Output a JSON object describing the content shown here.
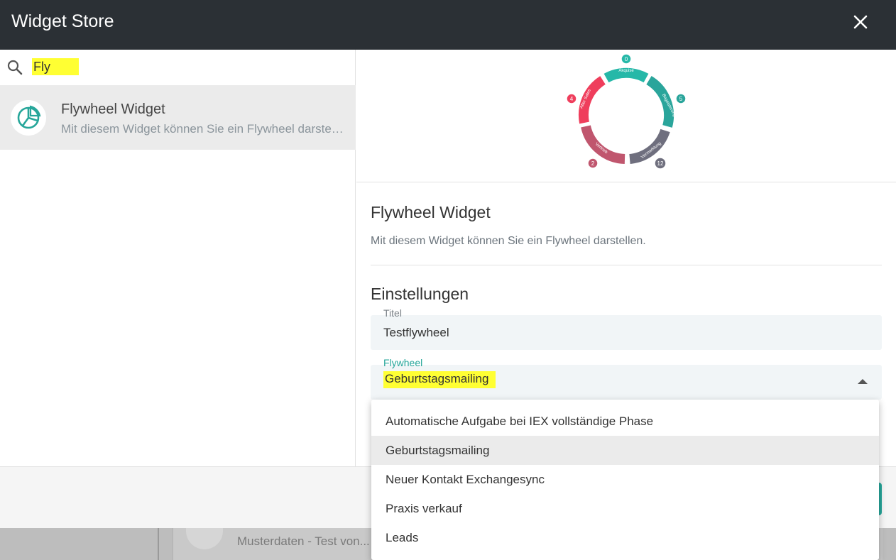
{
  "dialog": {
    "title": "Widget Store",
    "close_icon": "close-icon"
  },
  "search": {
    "icon": "search-icon",
    "value": "Fly",
    "highlight_color": "#ffff33"
  },
  "results": [
    {
      "icon": "flywheel-chart-icon",
      "title": "Flywheel Widget",
      "description": "Mit diesem Widget können Sie ein Flywheel darstellen."
    }
  ],
  "preview": {
    "segments": [
      {
        "label": "Akquise",
        "count": "0",
        "color": "#26b8a8"
      },
      {
        "label": "Begeisterung",
        "count": "5",
        "color": "#2aa59b"
      },
      {
        "label": "Vermarktung",
        "count": "12",
        "color": "#6f6f7e"
      },
      {
        "label": "Vertrieb",
        "count": "2",
        "color": "#c0566e"
      },
      {
        "label": "After Sales",
        "count": "4",
        "color": "#ef3e5c"
      }
    ]
  },
  "details": {
    "title": "Flywheel Widget",
    "description": "Mit diesem Widget können Sie ein Flywheel darstellen.",
    "settings_heading": "Einstellungen"
  },
  "fields": {
    "title": {
      "label": "Titel",
      "value": "Testflywheel"
    },
    "flywheel": {
      "label": "Flywheel",
      "value": "Geburtstagsmailing"
    }
  },
  "dropdown": {
    "options": [
      "Automatische Aufgabe bei IEX vollständige Phase",
      "Geburtstagsmailing",
      "Neuer Kontakt Exchangesync",
      "Praxis verkauf",
      "Leads"
    ],
    "selected_index": 1
  },
  "background": {
    "card_text": "Musterdaten - Test von..."
  },
  "colors": {
    "titlebar": "#2b3035",
    "accent": "#26a69a"
  }
}
